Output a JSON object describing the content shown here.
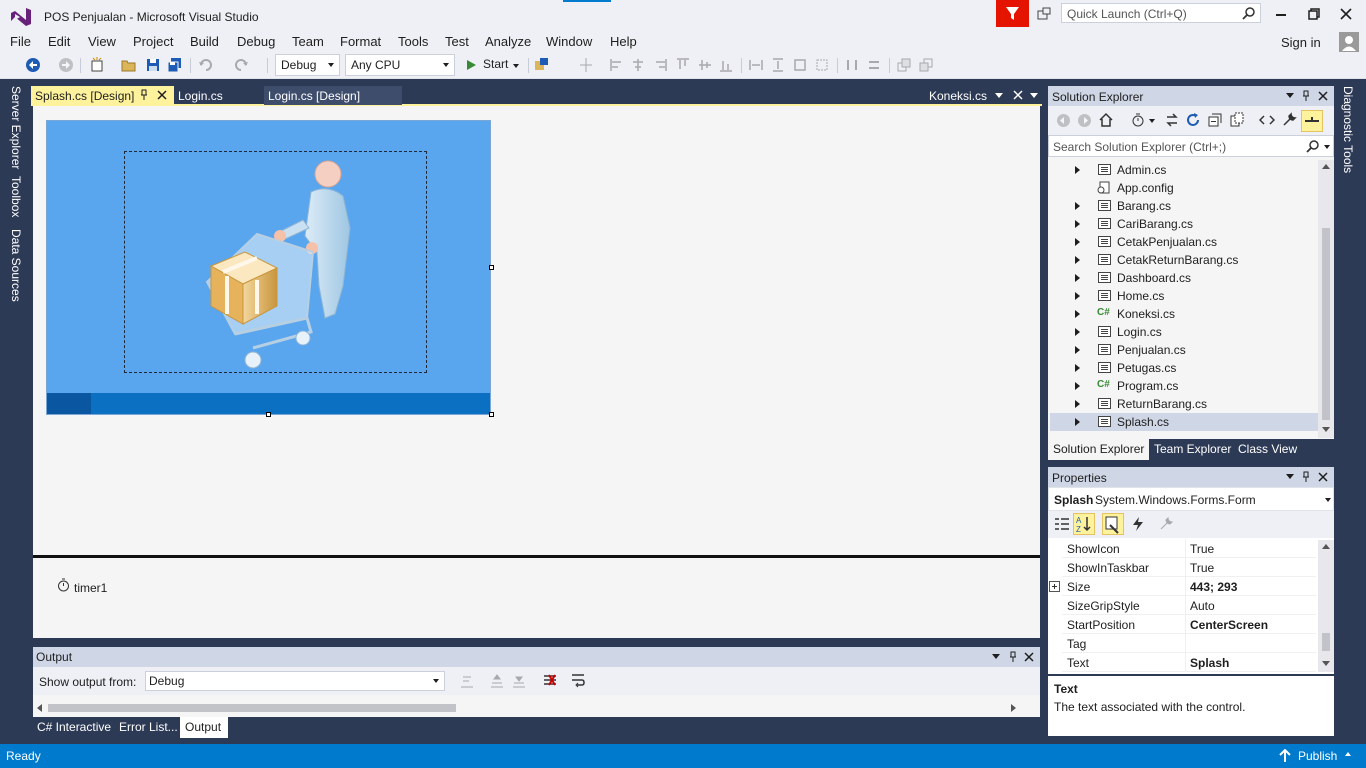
{
  "window": {
    "title": "POS Penjualan - Microsoft Visual Studio",
    "quick_launch_placeholder": "Quick Launch (Ctrl+Q)",
    "sign_in": "Sign in"
  },
  "menu": [
    "File",
    "Edit",
    "View",
    "Project",
    "Build",
    "Debug",
    "Team",
    "Format",
    "Tools",
    "Test",
    "Analyze",
    "Window",
    "Help"
  ],
  "toolbar": {
    "config": "Debug",
    "platform": "Any CPU",
    "start": "Start"
  },
  "left_rail": [
    "Server Explorer",
    "Toolbox",
    "Data Sources"
  ],
  "right_rail": [
    "Diagnostic Tools"
  ],
  "doc_tabs": {
    "active": "Splash.cs [Design]",
    "tab2": "Login.cs",
    "tab3": "Login.cs [Design]",
    "right_tab": "Koneksi.cs"
  },
  "tray": {
    "component": "timer1"
  },
  "solution_explorer": {
    "title": "Solution Explorer",
    "search_placeholder": "Search Solution Explorer (Ctrl+;)",
    "items": [
      {
        "label": "Admin.cs",
        "icon": "form-icon",
        "expandable": true
      },
      {
        "label": "App.config",
        "icon": "config-icon",
        "expandable": false
      },
      {
        "label": "Barang.cs",
        "icon": "form-icon",
        "expandable": true
      },
      {
        "label": "CariBarang.cs",
        "icon": "form-icon",
        "expandable": true
      },
      {
        "label": "CetakPenjualan.cs",
        "icon": "form-icon",
        "expandable": true
      },
      {
        "label": "CetakReturnBarang.cs",
        "icon": "form-icon",
        "expandable": true
      },
      {
        "label": "Dashboard.cs",
        "icon": "form-icon",
        "expandable": true
      },
      {
        "label": "Home.cs",
        "icon": "form-icon",
        "expandable": true
      },
      {
        "label": "Koneksi.cs",
        "icon": "csharp-icon",
        "expandable": true
      },
      {
        "label": "Login.cs",
        "icon": "form-icon",
        "expandable": true
      },
      {
        "label": "Penjualan.cs",
        "icon": "form-icon",
        "expandable": true
      },
      {
        "label": "Petugas.cs",
        "icon": "form-icon",
        "expandable": true
      },
      {
        "label": "Program.cs",
        "icon": "csharp-icon",
        "expandable": true
      },
      {
        "label": "ReturnBarang.cs",
        "icon": "form-icon",
        "expandable": true
      },
      {
        "label": "Splash.cs",
        "icon": "form-icon",
        "expandable": true,
        "selected": true
      }
    ],
    "tabs": [
      "Solution Explorer",
      "Team Explorer",
      "Class View"
    ],
    "csharp_glyph": "C#"
  },
  "properties": {
    "title": "Properties",
    "object_name": "Splash",
    "object_type": "System.Windows.Forms.Form",
    "rows": [
      {
        "name": "ShowIcon",
        "value": "True",
        "bold": false
      },
      {
        "name": "ShowInTaskbar",
        "value": "True",
        "bold": false
      },
      {
        "name": "Size",
        "value": "443; 293",
        "bold": true,
        "expand": true
      },
      {
        "name": "SizeGripStyle",
        "value": "Auto",
        "bold": false
      },
      {
        "name": "StartPosition",
        "value": "CenterScreen",
        "bold": true
      },
      {
        "name": "Tag",
        "value": "",
        "bold": false
      },
      {
        "name": "Text",
        "value": "Splash",
        "bold": true
      }
    ],
    "desc_title": "Text",
    "desc_text": "The text associated with the control."
  },
  "output": {
    "title": "Output",
    "show_from_label": "Show output from:",
    "source": "Debug"
  },
  "bottom_tabs": [
    "C# Interactive",
    "Error List...",
    "Output"
  ],
  "status": {
    "text": "Ready",
    "publish": "Publish"
  },
  "colors": {
    "accent": "#007acc",
    "form_bg": "#5aa6ee",
    "progress": "#0c70c2",
    "chrome": "#2d3a56"
  }
}
